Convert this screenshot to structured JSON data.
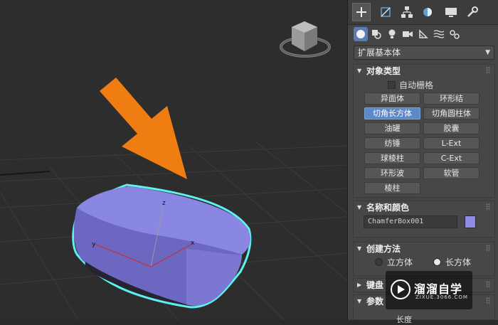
{
  "viewport": {
    "gizmo_labels": {
      "x": "x",
      "y": "y",
      "z": "z"
    },
    "colors": {
      "background": "#2d2d2d",
      "object": "#8f8be8",
      "selection": "#5ff0f0",
      "arrow": "#f07d12"
    }
  },
  "command_panel": {
    "tabs": [
      "create-icon",
      "modify-icon",
      "hierarchy-icon",
      "motion-icon",
      "display-icon",
      "utilities-icon"
    ],
    "categories": [
      "geometry-icon",
      "shapes-icon",
      "lights-icon",
      "cameras-icon",
      "helpers-icon",
      "spacewarps-icon",
      "systems-icon"
    ],
    "dropdown_value": "扩展基本体",
    "object_type": {
      "title": "对象类型",
      "autogrid_label": "自动栅格",
      "buttons": [
        "异面体",
        "环形结",
        "切角长方体",
        "切角圆柱体",
        "油罐",
        "胶囊",
        "纺锤",
        "L-Ext",
        "球棱柱",
        "C-Ext",
        "环形波",
        "软管",
        "棱柱"
      ],
      "active_button": "切角长方体"
    },
    "name_color": {
      "title": "名称和颜色",
      "name_value": "ChamferBox001",
      "color": "#8f8be8"
    },
    "creation_method": {
      "title": "创建方法",
      "option_cube": "立方体",
      "option_box": "长方体",
      "selected": "长方体"
    },
    "keyboard": {
      "title": "键盘"
    },
    "parameters": {
      "title": "参数",
      "length_label": "长度"
    }
  },
  "watermark": {
    "title": "溜溜自学",
    "subtitle": "ZIXUE.3066.COM"
  }
}
